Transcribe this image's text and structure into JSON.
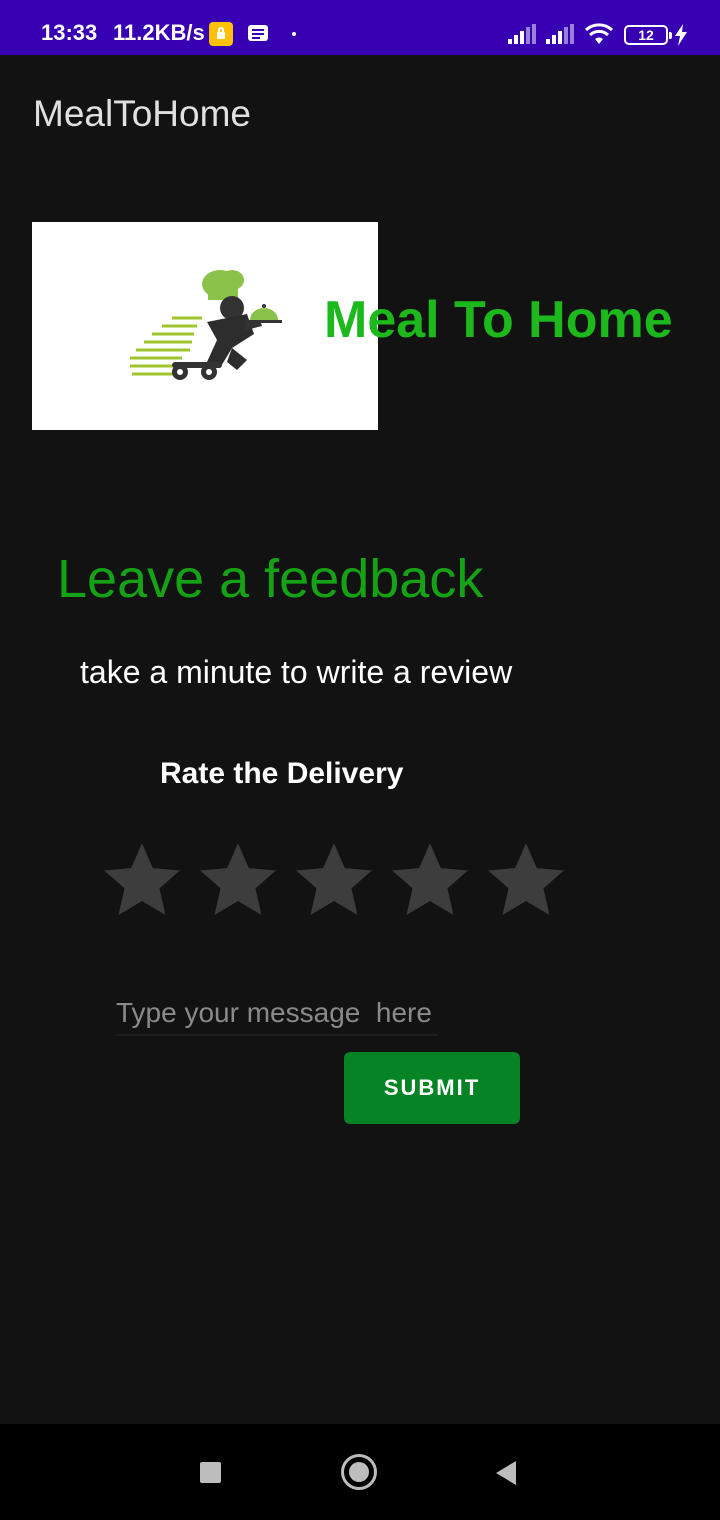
{
  "status_bar": {
    "time": "13:33",
    "speed": "11.2KB/s",
    "battery": "12"
  },
  "toolbar": {
    "title": "MealToHome"
  },
  "brand": {
    "text": "Meal To Home"
  },
  "feedback": {
    "heading": "Leave a feedback",
    "subtitle": "take a minute to write a review",
    "rate_label": "Rate the Delivery",
    "rating": 0,
    "max_rating": 5,
    "message_placeholder": "Type your message  here",
    "message_value": "",
    "submit_label": "SUBMIT"
  },
  "colors": {
    "status_bar": "#3700b3",
    "background": "#121212",
    "accent_green": "#15a315",
    "button_green": "#068325",
    "star_empty": "#3d3d3d"
  }
}
